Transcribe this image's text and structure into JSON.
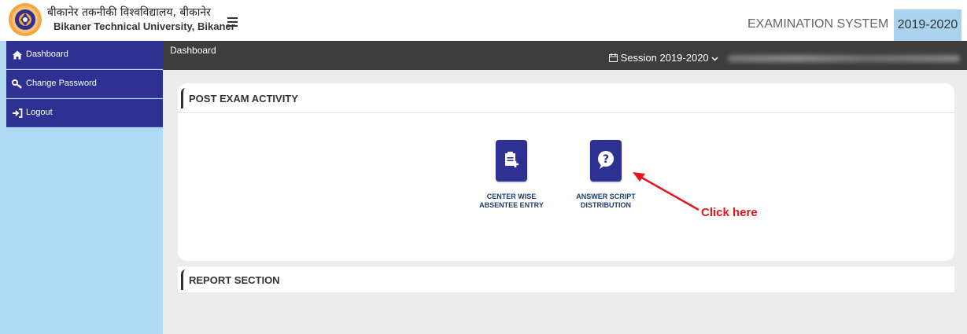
{
  "header": {
    "university_hindi": "बीकानेर तकनीकी विश्वविद्यालय, बीकानेर",
    "university_english": "Bikaner Technical University, Bikaner",
    "system_title": "EXAMINATION SYSTEM",
    "year": "2019-2020"
  },
  "topbar": {
    "title": "Dashboard",
    "session_label": "Session  2019-2020"
  },
  "sidebar": {
    "items": [
      {
        "label": "Dashboard",
        "icon": "home-icon"
      },
      {
        "label": "Change Password",
        "icon": "key-icon"
      },
      {
        "label": "Logout",
        "icon": "logout-icon"
      }
    ]
  },
  "post_exam": {
    "title": "POST EXAM ACTIVITY",
    "tiles": [
      {
        "line1": "CENTER WISE",
        "line2": "ABSENTEE ENTRY",
        "icon": "clipboard-add-icon"
      },
      {
        "line1": "ANSWER SCRIPT",
        "line2": "DISTRIBUTION",
        "icon": "question-bubble-icon"
      }
    ]
  },
  "annotation": {
    "text": "Click here",
    "color": "#e8141c"
  },
  "report": {
    "title": "REPORT SECTION"
  },
  "colors": {
    "brand_navy": "#2e3192",
    "sidebar_bg": "#aedaf4",
    "topbar_bg": "#3d3d3d",
    "year_bg": "#a9d3ee"
  }
}
